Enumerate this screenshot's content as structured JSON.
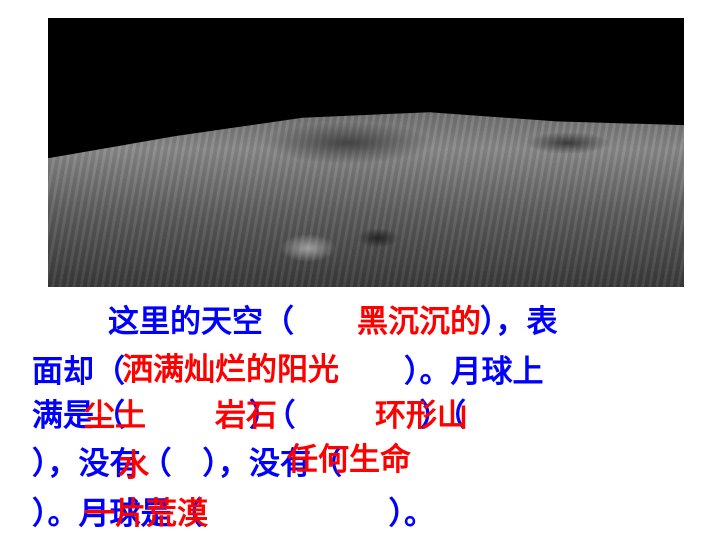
{
  "colors": {
    "question": "#0000FF",
    "answer": "#FF0000"
  },
  "question_lines": [
    "这里的天空（　　　　　　），表",
    "面却（　　　　　　　　　）。月球上",
    "满是（　　　　）（　　　　）（",
    "），没有（　），没有（",
    "）。月球是（　　　　　　）。"
  ],
  "answers": {
    "sky": "黑沉沉的",
    "surface": "洒满灿烂的阳光",
    "dust": "尘土",
    "rock": "岩石",
    "mountain": "环形山",
    "water": "水",
    "life": "任何生命",
    "desert": "一片荒漠"
  }
}
